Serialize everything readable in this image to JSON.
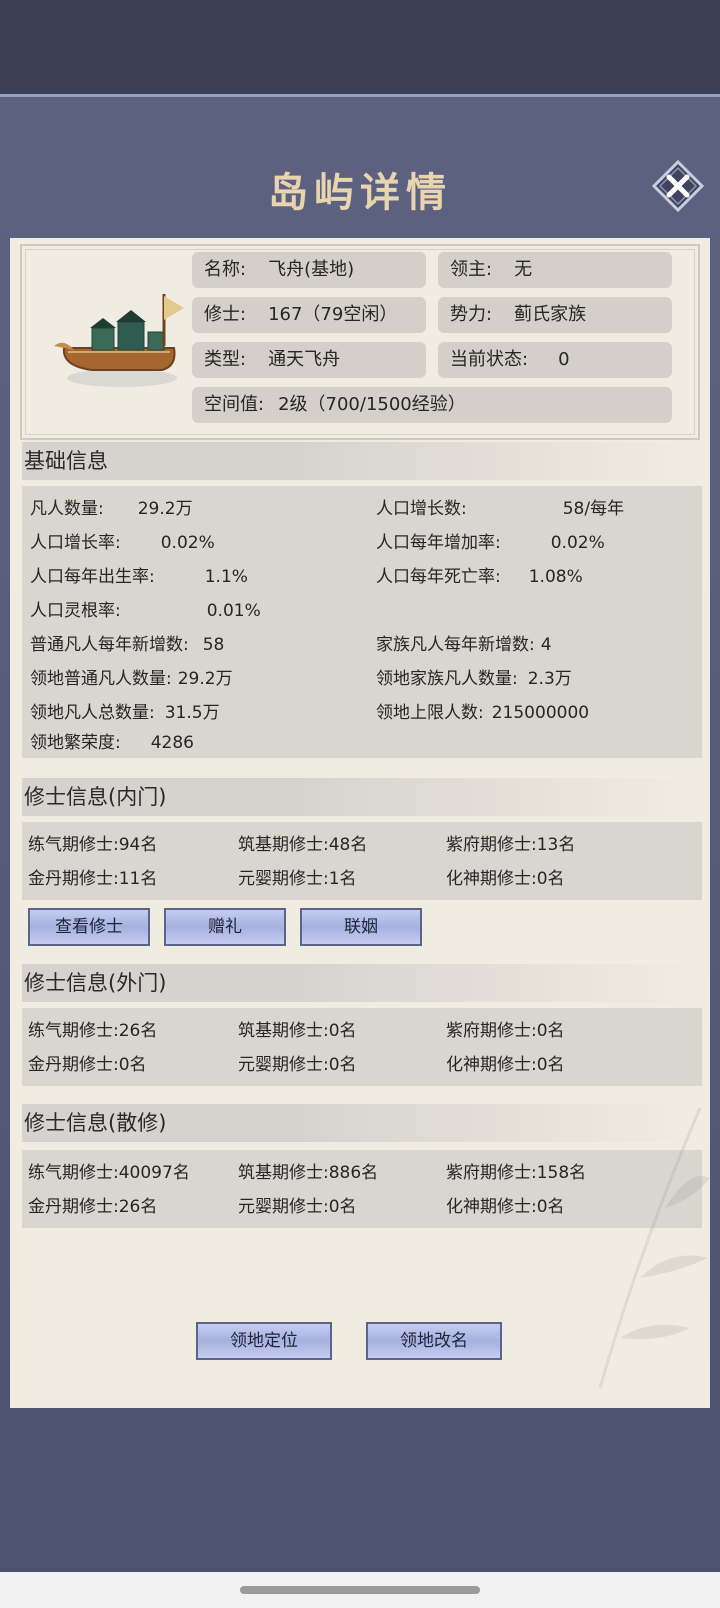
{
  "dialog": {
    "title": "岛屿详情"
  },
  "header": {
    "name": {
      "label": "名称:",
      "value": "飞舟(基地)"
    },
    "lord": {
      "label": "领主:",
      "value": "无"
    },
    "cultivators": {
      "label": "修士:",
      "value": "167（79空闲）"
    },
    "faction": {
      "label": "势力:",
      "value": "蓟氏家族"
    },
    "type": {
      "label": "类型:",
      "value": "通天飞舟"
    },
    "status": {
      "label": "当前状态:",
      "value": "0"
    },
    "space": {
      "label": "空间值:",
      "value": "2级（700/1500经验）"
    }
  },
  "basic": {
    "title": "基础信息",
    "mortals": {
      "label": "凡人数量:",
      "value": "29.2万"
    },
    "pop_growth": {
      "label": "人口增长数:",
      "value": "58/每年"
    },
    "growth_rate": {
      "label": "人口增长率:",
      "value": "0.02%"
    },
    "yearly_increase_rate": {
      "label": "人口每年增加率:",
      "value": "0.02%"
    },
    "birth_rate": {
      "label": "人口每年出生率:",
      "value": "1.1%"
    },
    "death_rate": {
      "label": "人口每年死亡率:",
      "value": "1.08%"
    },
    "spirit_root_rate": {
      "label": "人口灵根率:",
      "value": "0.01%"
    },
    "common_new": {
      "label": "普通凡人每年新增数:",
      "value": "58"
    },
    "family_new": {
      "label": "家族凡人每年新增数:",
      "value": "4"
    },
    "territory_common": {
      "label": "领地普通凡人数量:",
      "value": "29.2万"
    },
    "territory_family": {
      "label": "领地家族凡人数量:",
      "value": "2.3万"
    },
    "territory_total": {
      "label": "领地凡人总数量:",
      "value": "31.5万"
    },
    "territory_cap": {
      "label": "领地上限人数:",
      "value": "215000000"
    },
    "prosperity": {
      "label": "领地繁荣度:",
      "value": "4286"
    }
  },
  "inner": {
    "title": "修士信息(内门)",
    "rows": [
      {
        "label": "练气期修士:",
        "value": "94名"
      },
      {
        "label": "筑基期修士:",
        "value": "48名"
      },
      {
        "label": "紫府期修士:",
        "value": "13名"
      },
      {
        "label": "金丹期修士:",
        "value": "11名"
      },
      {
        "label": "元婴期修士:",
        "value": "1名"
      },
      {
        "label": "化神期修士:",
        "value": "0名"
      }
    ],
    "buttons": {
      "view": "查看修士",
      "gift": "赠礼",
      "marriage": "联姻"
    }
  },
  "outer": {
    "title": "修士信息(外门)",
    "rows": [
      {
        "label": "练气期修士:",
        "value": "26名"
      },
      {
        "label": "筑基期修士:",
        "value": "0名"
      },
      {
        "label": "紫府期修士:",
        "value": "0名"
      },
      {
        "label": "金丹期修士:",
        "value": "0名"
      },
      {
        "label": "元婴期修士:",
        "value": "0名"
      },
      {
        "label": "化神期修士:",
        "value": "0名"
      }
    ]
  },
  "rogue": {
    "title": "修士信息(散修)",
    "rows": [
      {
        "label": "练气期修士:",
        "value": "40097名"
      },
      {
        "label": "筑基期修士:",
        "value": "886名"
      },
      {
        "label": "紫府期修士:",
        "value": "158名"
      },
      {
        "label": "金丹期修士:",
        "value": "26名"
      },
      {
        "label": "元婴期修士:",
        "value": "0名"
      },
      {
        "label": "化神期修士:",
        "value": "0名"
      }
    ]
  },
  "footer": {
    "locate": "领地定位",
    "rename": "领地改名"
  }
}
